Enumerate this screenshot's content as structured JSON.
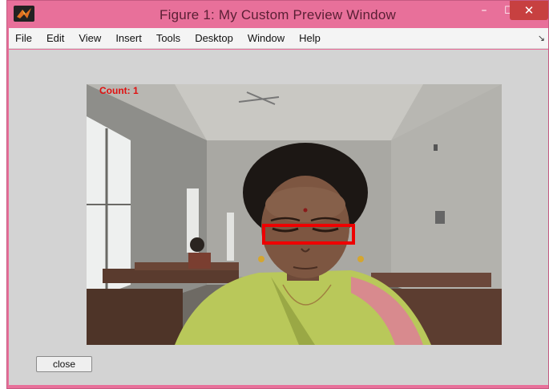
{
  "window": {
    "title": "Figure 1: My Custom Preview Window",
    "controls": {
      "minimize": "–",
      "maximize": "☐",
      "close": "✕"
    }
  },
  "menu": [
    "File",
    "Edit",
    "View",
    "Insert",
    "Tools",
    "Desktop",
    "Window",
    "Help"
  ],
  "preview": {
    "count_label": "Count: 1",
    "detection_color": "#ee0000"
  },
  "buttons": {
    "close_label": "close"
  },
  "colors": {
    "titlebar": "#e8709a",
    "figure_bg": "#d3d3d3"
  }
}
